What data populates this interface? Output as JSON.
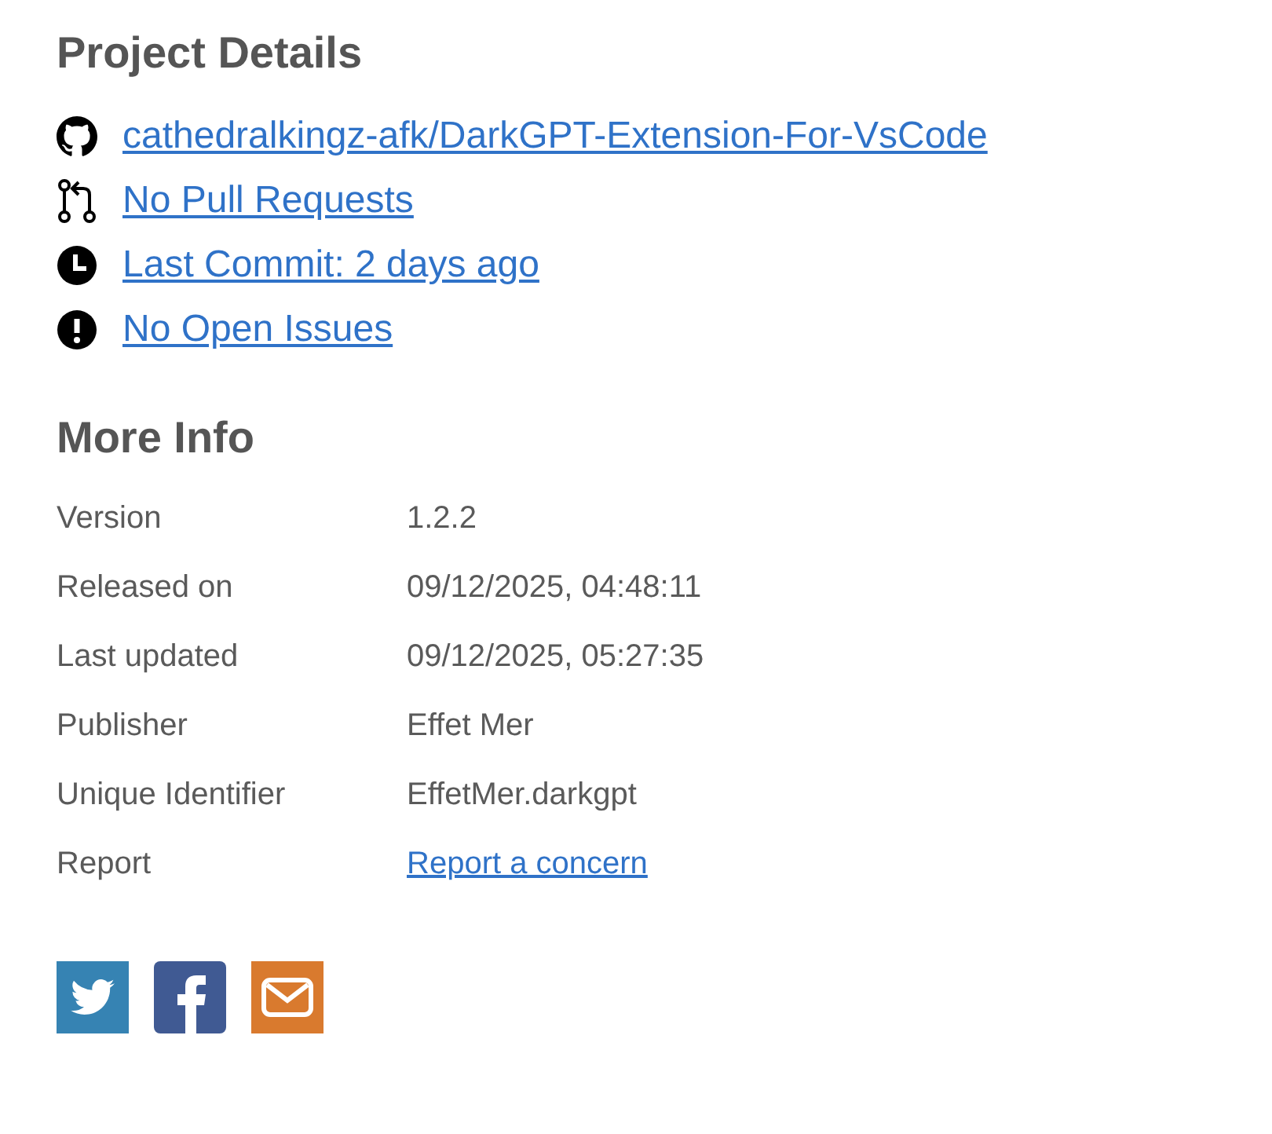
{
  "project_details": {
    "heading": "Project Details",
    "links": [
      {
        "kind": "repo",
        "label": "cathedralkingz-afk/DarkGPT-Extension-For-VsCode"
      },
      {
        "kind": "pulls",
        "label": "No Pull Requests"
      },
      {
        "kind": "commit",
        "label": "Last Commit: 2 days ago"
      },
      {
        "kind": "issues",
        "label": "No Open Issues"
      }
    ]
  },
  "more_info": {
    "heading": "More Info",
    "rows": [
      {
        "kind": "text",
        "label": "Version",
        "value": "1.2.2"
      },
      {
        "kind": "text",
        "label": "Released on",
        "value": "09/12/2025, 04:48:11"
      },
      {
        "kind": "text",
        "label": "Last updated",
        "value": "09/12/2025, 05:27:35"
      },
      {
        "kind": "text",
        "label": "Publisher",
        "value": "Effet Mer"
      },
      {
        "kind": "text",
        "label": "Unique Identifier",
        "value": "EffetMer.darkgpt"
      },
      {
        "kind": "link",
        "label": "Report",
        "value": "Report a concern"
      }
    ]
  },
  "share": [
    {
      "kind": "twitter"
    },
    {
      "kind": "facebook"
    },
    {
      "kind": "email"
    }
  ]
}
